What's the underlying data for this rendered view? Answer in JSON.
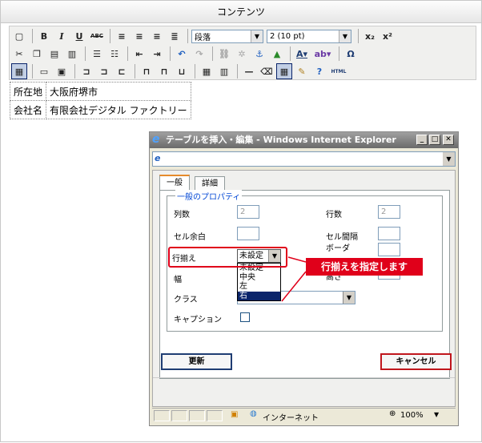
{
  "panel": {
    "title": "コンテンツ"
  },
  "toolbar": {
    "format_select": "段落",
    "size_select": "2 (10 pt)",
    "bold": "B",
    "italic": "I",
    "underline": "U",
    "strike": "ABC",
    "sub": "x₂",
    "sup": "x²",
    "omega": "Ω",
    "html": "HTML"
  },
  "content_table": [
    [
      "所在地",
      "大阪府堺市"
    ],
    [
      "会社名",
      "有限会社デジタル ファクトリー"
    ]
  ],
  "dialog": {
    "window_title": "テーブルを挿入・編集 - Windows Internet Explorer",
    "tabs": [
      "一般",
      "詳細"
    ],
    "legend": "一般のプロパティ",
    "cols_label": "列数",
    "cols_value": "2",
    "rows_label": "行数",
    "rows_value": "2",
    "padding_label": "セル余白",
    "spacing_label": "セル間隔",
    "align_label": "行揃え",
    "align_selected": "未設定",
    "align_options": [
      "未設定",
      "中央",
      "左",
      "右"
    ],
    "border_label": "ボーダ",
    "width_label": "幅",
    "height_label": "高さ",
    "class_label": "クラス",
    "caption_label": "キャプション",
    "update_button": "更新",
    "cancel_button": "キャンセル",
    "status_zone": "インターネット",
    "zoom": "100%"
  },
  "callout": {
    "text": "行揃えを指定します"
  },
  "colors": {
    "highlight": "#e0001a",
    "legend": "#0046d5"
  }
}
